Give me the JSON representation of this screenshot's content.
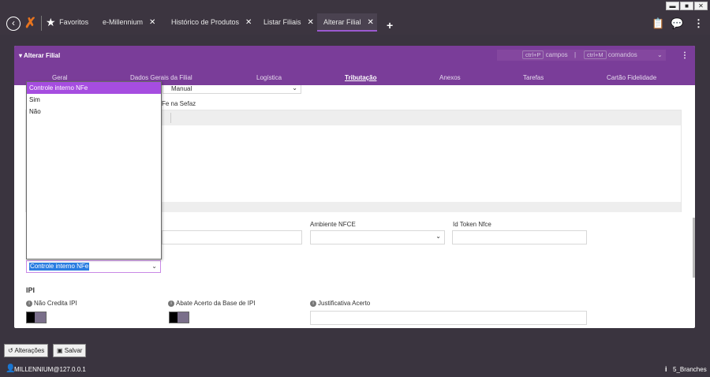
{
  "window": {
    "minimize": "▬",
    "maximize": "■",
    "close": "✕"
  },
  "topbar": {
    "favorites": "Favoritos",
    "tabs": [
      {
        "label": "e-Millennium"
      },
      {
        "label": "Histórico de Produtos"
      },
      {
        "label": "Listar Filiais"
      },
      {
        "label": "Alterar Filial"
      }
    ],
    "add_tab": "+"
  },
  "panel": {
    "title": "Alterar Filial",
    "shortcut1_key": "ctrl+P",
    "shortcut1_label": "campos",
    "divider": "|",
    "shortcut2_key": "ctrl+M",
    "shortcut2_label": "comandos",
    "tabs": [
      "Geral",
      "Dados Gerais da Filial",
      "Logística",
      "Tributação",
      "Anexos",
      "Tarefas",
      "Cartão Fidelidade"
    ],
    "active_tab": "Tributação"
  },
  "form": {
    "manual_value": "Manual",
    "nfe_label_partial": "Fe na Sefaz",
    "ambiente_nfce_label": "Ambiente NFCE",
    "id_token_label": "Id Token Nfce",
    "select_value": "Controle interno NFe",
    "section_ipi": "IPI",
    "nao_credita_label": "Não Credita IPI",
    "abate_label": "Abate Acerto da Base de IPI",
    "justificativa_label": "Justificativa Acerto"
  },
  "dropdown": {
    "options": [
      "Controle interno NFe",
      "Sim",
      "Não"
    ],
    "selected": "Controle interno NFe"
  },
  "bottom": {
    "alteracoes": "Alterações",
    "salvar": "Salvar",
    "user": "MILLENNIUM@127.0.0.1",
    "branch": "5_Branches"
  }
}
